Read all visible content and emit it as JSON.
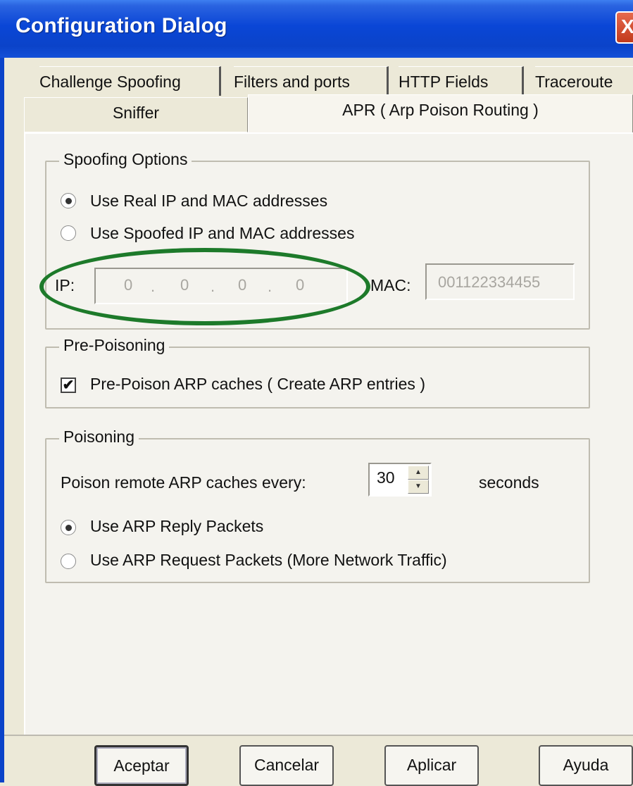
{
  "window": {
    "title": "Configuration Dialog"
  },
  "tabs": {
    "row1": [
      "Challenge Spoofing",
      "Filters and ports",
      "HTTP Fields",
      "Traceroute"
    ],
    "row2": [
      "Sniffer",
      "APR ( Arp Poison Routing )"
    ],
    "active": "APR ( Arp Poison Routing )"
  },
  "spoofing": {
    "legend": "Spoofing Options",
    "option_real": "Use Real IP and MAC addresses",
    "option_spoofed": "Use Spoofed IP and MAC addresses",
    "selected": "real",
    "ip_label": "IP:",
    "ip": [
      "0",
      "0",
      "0",
      "0"
    ],
    "ip_separator": ".",
    "mac_label": "MAC:",
    "mac": "001122334455",
    "annotation_color": "#1d7a2a"
  },
  "prepoisoning": {
    "legend": "Pre-Poisoning",
    "checkbox_label": "Pre-Poison ARP caches ( Create ARP entries )",
    "checked": true,
    "check_mark": "✔"
  },
  "poisoning": {
    "legend": "Poisoning",
    "interval_label": "Poison remote ARP caches every:",
    "interval_value": "30",
    "interval_unit": "seconds",
    "option_reply": "Use ARP Reply Packets",
    "option_request": "Use ARP Request Packets (More Network Traffic)",
    "selected": "reply"
  },
  "buttons": {
    "ok": "Aceptar",
    "cancel": "Cancelar",
    "apply": "Aplicar",
    "help": "Ayuda"
  },
  "icons": {
    "close": "close-icon",
    "spin_up": "▲",
    "spin_down": "▼",
    "close_glyph": "X"
  }
}
